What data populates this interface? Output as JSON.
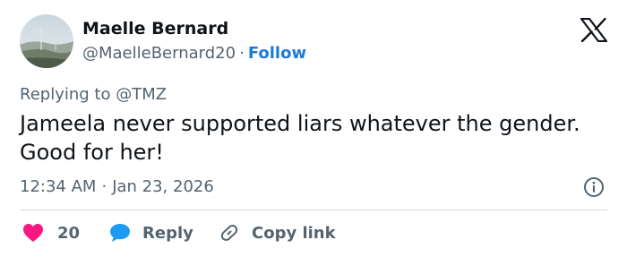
{
  "author": {
    "name": "Maelle Bernard",
    "handle": "@MaelleBernard20",
    "separator": "·",
    "follow_label": "Follow"
  },
  "reply_context": "Replying to @TMZ",
  "text": "Jameela never supported liars whatever the gender. Good for her!",
  "meta": {
    "time": "12:34 AM",
    "separator": "·",
    "date": "Jan 23, 2026"
  },
  "actions": {
    "like_count": "20",
    "reply_label": "Reply",
    "copy_label": "Copy link"
  },
  "icons": {
    "platform": "x-logo-icon",
    "info": "info-icon",
    "like": "heart-icon",
    "reply": "speech-bubble-icon",
    "copy": "link-icon"
  },
  "colors": {
    "follow": "#1d7bd8",
    "heart": "#f91880",
    "reply_bubble": "#1d9bf0",
    "secondary_text": "#536471",
    "primary_text": "#0f1419"
  }
}
